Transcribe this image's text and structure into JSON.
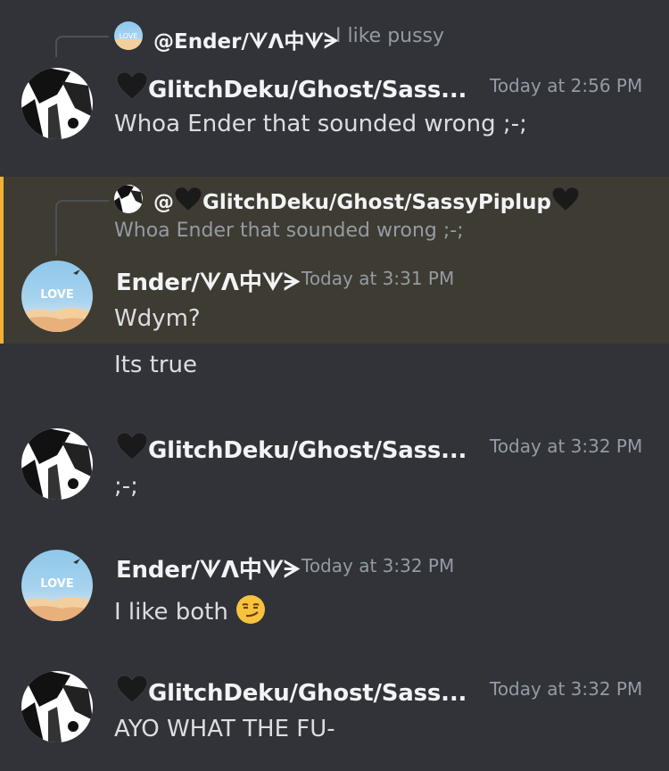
{
  "messages": {
    "m1": {
      "reply": {
        "mention": "@Ender/ᗐᐱ中ᗐᗒ",
        "text": "I like pussy"
      },
      "author": "GlitchDeku/Ghost/Sass...",
      "timestamp": "Today at 2:56 PM",
      "lines": [
        "Whoa Ender that sounded wrong ;-;"
      ]
    },
    "m2": {
      "reply": {
        "mention": "@",
        "mention_name": "GlitchDeku/Ghost/SassyPiplup",
        "text": "Whoa Ender that sounded wrong ;-;"
      },
      "author": "Ender/ᗐᐱ中ᗐᗒ",
      "timestamp": "Today at 3:31 PM",
      "lines": [
        "Wdym?",
        "Its true"
      ]
    },
    "m3": {
      "author": "GlitchDeku/Ghost/Sass...",
      "timestamp": "Today at 3:32 PM",
      "lines": [
        ";-;"
      ]
    },
    "m4": {
      "author": "Ender/ᗐᐱ中ᗐᗒ",
      "timestamp": "Today at 3:32 PM",
      "lines": [
        "I like both"
      ],
      "emoji": "😏"
    },
    "m5": {
      "author": "GlitchDeku/Ghost/Sass...",
      "timestamp": "Today at 3:32 PM",
      "lines": [
        "AYO WHAT THE FU-"
      ]
    }
  },
  "colors": {
    "background": "#313338",
    "highlight": "#3e3b33",
    "highlight_bar": "#f0b232",
    "name": "#f2f3f5",
    "text": "#dbdee1",
    "muted": "#949ba4"
  }
}
